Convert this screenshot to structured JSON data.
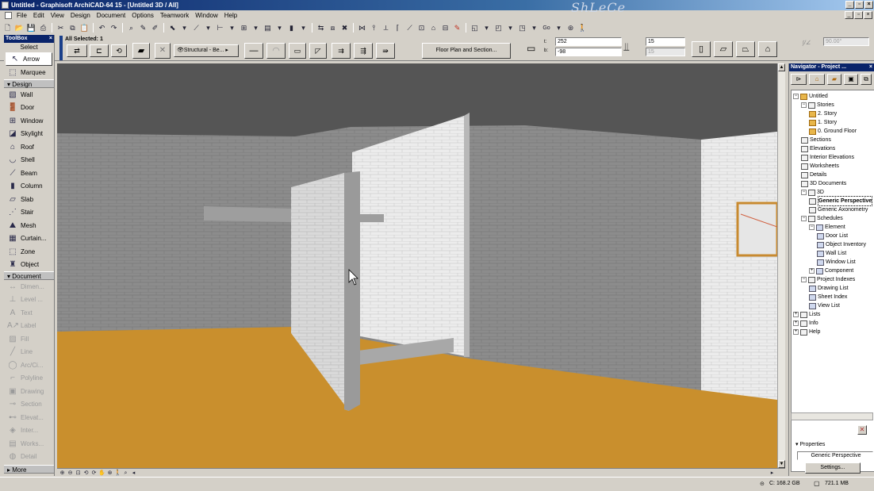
{
  "window": {
    "title": "Untitled - Graphisoft ArchiCAD-64 15 - [Untitled 3D / All]",
    "watermark": "ShLeCe"
  },
  "menu": [
    "File",
    "Edit",
    "View",
    "Design",
    "Document",
    "Options",
    "Teamwork",
    "Window",
    "Help"
  ],
  "std_toolbar": {
    "go_label": "Go"
  },
  "infobox": {
    "selection": "All Selected: 1",
    "structural": "Structural - Be...",
    "floor_plan_section": "Floor Plan and Section...",
    "t_label": "t:",
    "b_label": "b:",
    "t_value": "252",
    "b_value": "-98",
    "width_value": "15",
    "height_value": "15",
    "angle_value": "90.00°"
  },
  "toolbox": {
    "title": "ToolBox",
    "select_label": "Select",
    "arrow_label": "Arrow",
    "marquee_label": "Marquee",
    "design_header": "Design",
    "design_tools": [
      {
        "label": "Wall",
        "icon": "wall-icon"
      },
      {
        "label": "Door",
        "icon": "door-icon"
      },
      {
        "label": "Window",
        "icon": "window-icon"
      },
      {
        "label": "Skylight",
        "icon": "skylight-icon"
      },
      {
        "label": "Roof",
        "icon": "roof-icon"
      },
      {
        "label": "Shell",
        "icon": "shell-icon"
      },
      {
        "label": "Beam",
        "icon": "beam-icon"
      },
      {
        "label": "Column",
        "icon": "column-icon"
      },
      {
        "label": "Slab",
        "icon": "slab-icon"
      },
      {
        "label": "Stair",
        "icon": "stair-icon"
      },
      {
        "label": "Mesh",
        "icon": "mesh-icon"
      },
      {
        "label": "Curtain...",
        "icon": "curtain-wall-icon"
      },
      {
        "label": "Zone",
        "icon": "zone-icon"
      },
      {
        "label": "Object",
        "icon": "object-icon"
      }
    ],
    "document_header": "Document",
    "document_tools": [
      {
        "label": "Dimen...",
        "icon": "dimension-icon"
      },
      {
        "label": "Level ...",
        "icon": "level-dimension-icon"
      },
      {
        "label": "Text",
        "icon": "text-icon"
      },
      {
        "label": "Label",
        "icon": "label-icon"
      },
      {
        "label": "Fill",
        "icon": "fill-icon"
      },
      {
        "label": "Line",
        "icon": "line-icon"
      },
      {
        "label": "Arc/Ci...",
        "icon": "arc-circle-icon"
      },
      {
        "label": "Polyline",
        "icon": "polyline-icon"
      },
      {
        "label": "Drawing",
        "icon": "drawing-icon"
      },
      {
        "label": "Section",
        "icon": "section-icon"
      },
      {
        "label": "Elevat...",
        "icon": "elevation-icon"
      },
      {
        "label": "Inter...",
        "icon": "interior-elevation-icon"
      },
      {
        "label": "Works...",
        "icon": "worksheet-icon"
      },
      {
        "label": "Detail",
        "icon": "detail-icon"
      }
    ],
    "more_label": "More"
  },
  "navigator": {
    "title": "Navigator - Project ...",
    "tree": [
      {
        "label": "Untitled",
        "level": 0,
        "icon": "house",
        "exp": "-"
      },
      {
        "label": "Stories",
        "level": 1,
        "icon": "plan",
        "exp": "-"
      },
      {
        "label": "2. Story",
        "level": 2,
        "icon": "folder"
      },
      {
        "label": "1. Story",
        "level": 2,
        "icon": "folder"
      },
      {
        "label": "0. Ground Floor",
        "level": 2,
        "icon": "folder"
      },
      {
        "label": "Sections",
        "level": 1,
        "icon": "plan"
      },
      {
        "label": "Elevations",
        "level": 1,
        "icon": "plan"
      },
      {
        "label": "Interior Elevations",
        "level": 1,
        "icon": "plan"
      },
      {
        "label": "Worksheets",
        "level": 1,
        "icon": "plan"
      },
      {
        "label": "Details",
        "level": 1,
        "icon": "plan"
      },
      {
        "label": "3D Documents",
        "level": 1,
        "icon": "plan"
      },
      {
        "label": "3D",
        "level": 1,
        "icon": "plan",
        "exp": "-"
      },
      {
        "label": "Generic Perspective",
        "level": 2,
        "icon": "eye",
        "sel": true
      },
      {
        "label": "Generic Axonometry",
        "level": 2,
        "icon": "axo"
      },
      {
        "label": "Schedules",
        "level": 1,
        "icon": "plan",
        "exp": "-"
      },
      {
        "label": "Element",
        "level": 2,
        "icon": "sheet",
        "exp": "-"
      },
      {
        "label": "Door List",
        "level": 3,
        "icon": "sheet"
      },
      {
        "label": "Object Inventory",
        "level": 3,
        "icon": "sheet"
      },
      {
        "label": "Wall List",
        "level": 3,
        "icon": "sheet"
      },
      {
        "label": "Window List",
        "level": 3,
        "icon": "sheet"
      },
      {
        "label": "Component",
        "level": 2,
        "icon": "sheet",
        "exp": "+"
      },
      {
        "label": "Project Indexes",
        "level": 1,
        "icon": "plan",
        "exp": "-"
      },
      {
        "label": "Drawing List",
        "level": 2,
        "icon": "sheet"
      },
      {
        "label": "Sheet Index",
        "level": 2,
        "icon": "sheet"
      },
      {
        "label": "View List",
        "level": 2,
        "icon": "sheet"
      },
      {
        "label": "Lists",
        "level": 0,
        "icon": "plan",
        "exp": "+"
      },
      {
        "label": "Info",
        "level": 0,
        "icon": "plan",
        "exp": "+"
      },
      {
        "label": "Help",
        "level": 0,
        "icon": "plan",
        "exp": "+"
      }
    ],
    "properties_label": "Properties",
    "properties_value": "Generic Perspective",
    "settings_label": "Settings..."
  },
  "status": {
    "disk": "C: 168.2 GB",
    "memory": "721.1 MB"
  },
  "colors": {
    "floor": "#c8902e",
    "wall_gray": "#8a8a8a",
    "wall_white": "#e8e8e8",
    "sky": "#4e4e4e",
    "title_blue": "#0a246a"
  }
}
